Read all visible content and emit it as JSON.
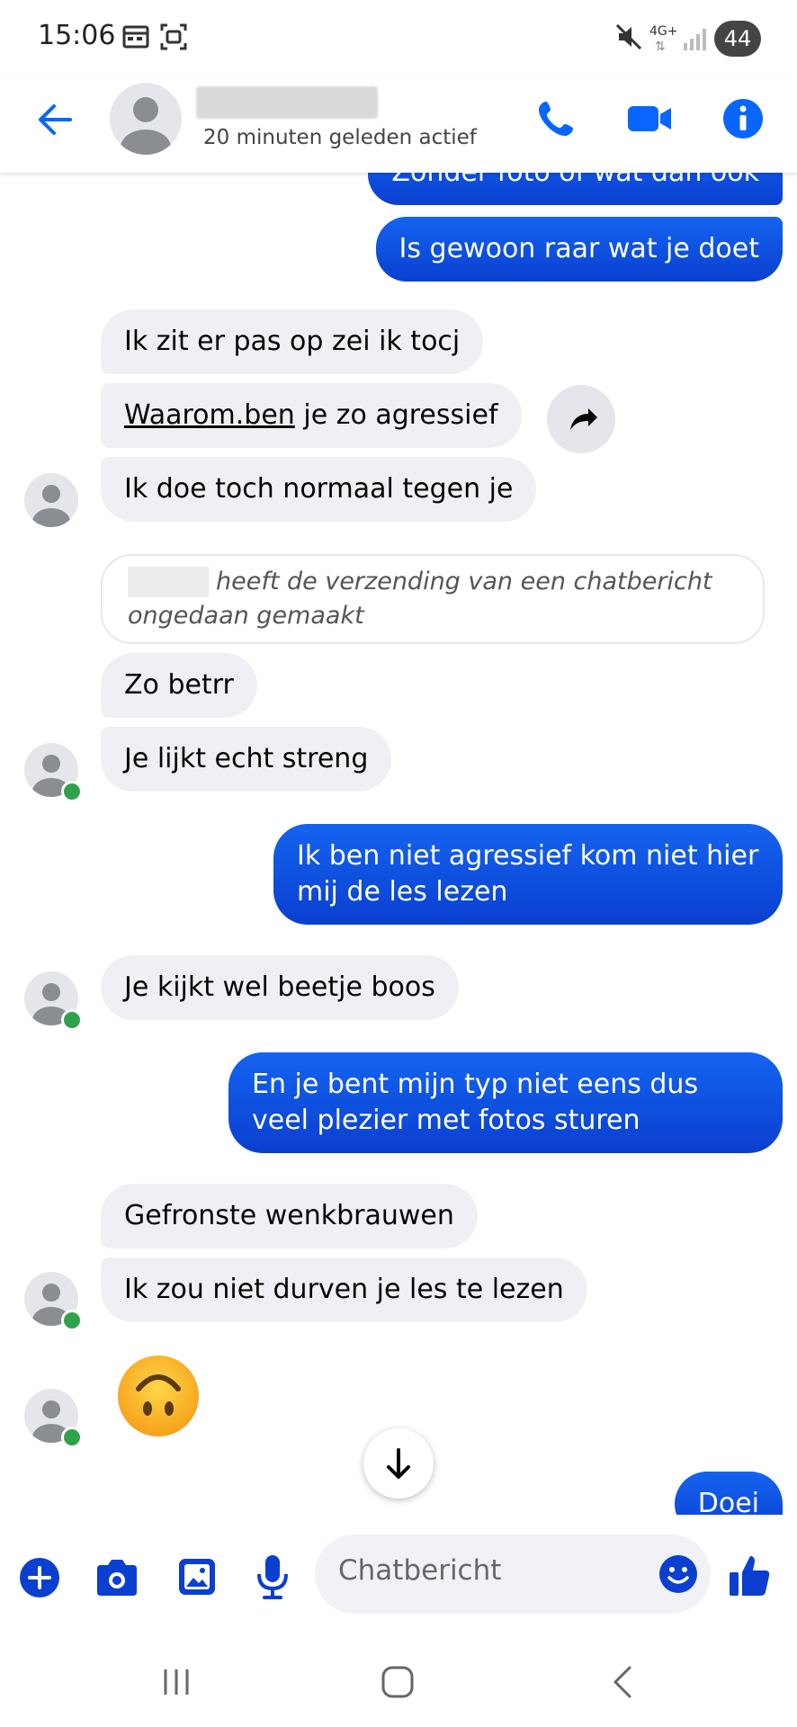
{
  "status_bar": {
    "time": "15:06",
    "network": "4G+",
    "battery": "44"
  },
  "header": {
    "last_active": "20 minuten geleden actief",
    "icons": [
      "back-arrow-icon",
      "phone-icon",
      "video-icon",
      "info-icon"
    ]
  },
  "messages": [
    {
      "dir": "out",
      "text": "Zonder foto of wat dan ook"
    },
    {
      "dir": "out",
      "text": "Is gewoon raar wat je doet"
    },
    {
      "dir": "in",
      "text": "Ik zit er pas op zei ik tocj"
    },
    {
      "dir": "in",
      "link": "Waarom.ben",
      "text": " je zo agressief"
    },
    {
      "dir": "in",
      "text": "Ik doe toch normaal tegen je"
    },
    {
      "dir": "system",
      "text": "heeft de verzending van een chatbericht ongedaan gemaakt"
    },
    {
      "dir": "in",
      "text": "Zo betrr"
    },
    {
      "dir": "in",
      "text": "Je lijkt echt streng"
    },
    {
      "dir": "out",
      "text": "Ik ben niet agressief kom niet hier mij de les lezen"
    },
    {
      "dir": "in",
      "text": "Je kijkt wel beetje boos"
    },
    {
      "dir": "out",
      "text": "En je bent mijn typ niet eens dus veel plezier met fotos sturen"
    },
    {
      "dir": "in",
      "text": "Gefronste wenkbrauwen"
    },
    {
      "dir": "in",
      "text": "Ik zou niet durven je les te lezen"
    },
    {
      "dir": "in",
      "emoji": "🙃"
    },
    {
      "dir": "out",
      "text": "Doei"
    }
  ],
  "composer": {
    "placeholder": "Chatbericht",
    "icons": [
      "plus-icon",
      "camera-icon",
      "image-icon",
      "microphone-icon",
      "emoji-icon",
      "thumbs-up-icon"
    ]
  },
  "colors": {
    "accent": "#0866ff",
    "outgoing_bubble": "#0a4fe0",
    "incoming_bubble": "#eef0f3",
    "online": "#31a24c"
  }
}
